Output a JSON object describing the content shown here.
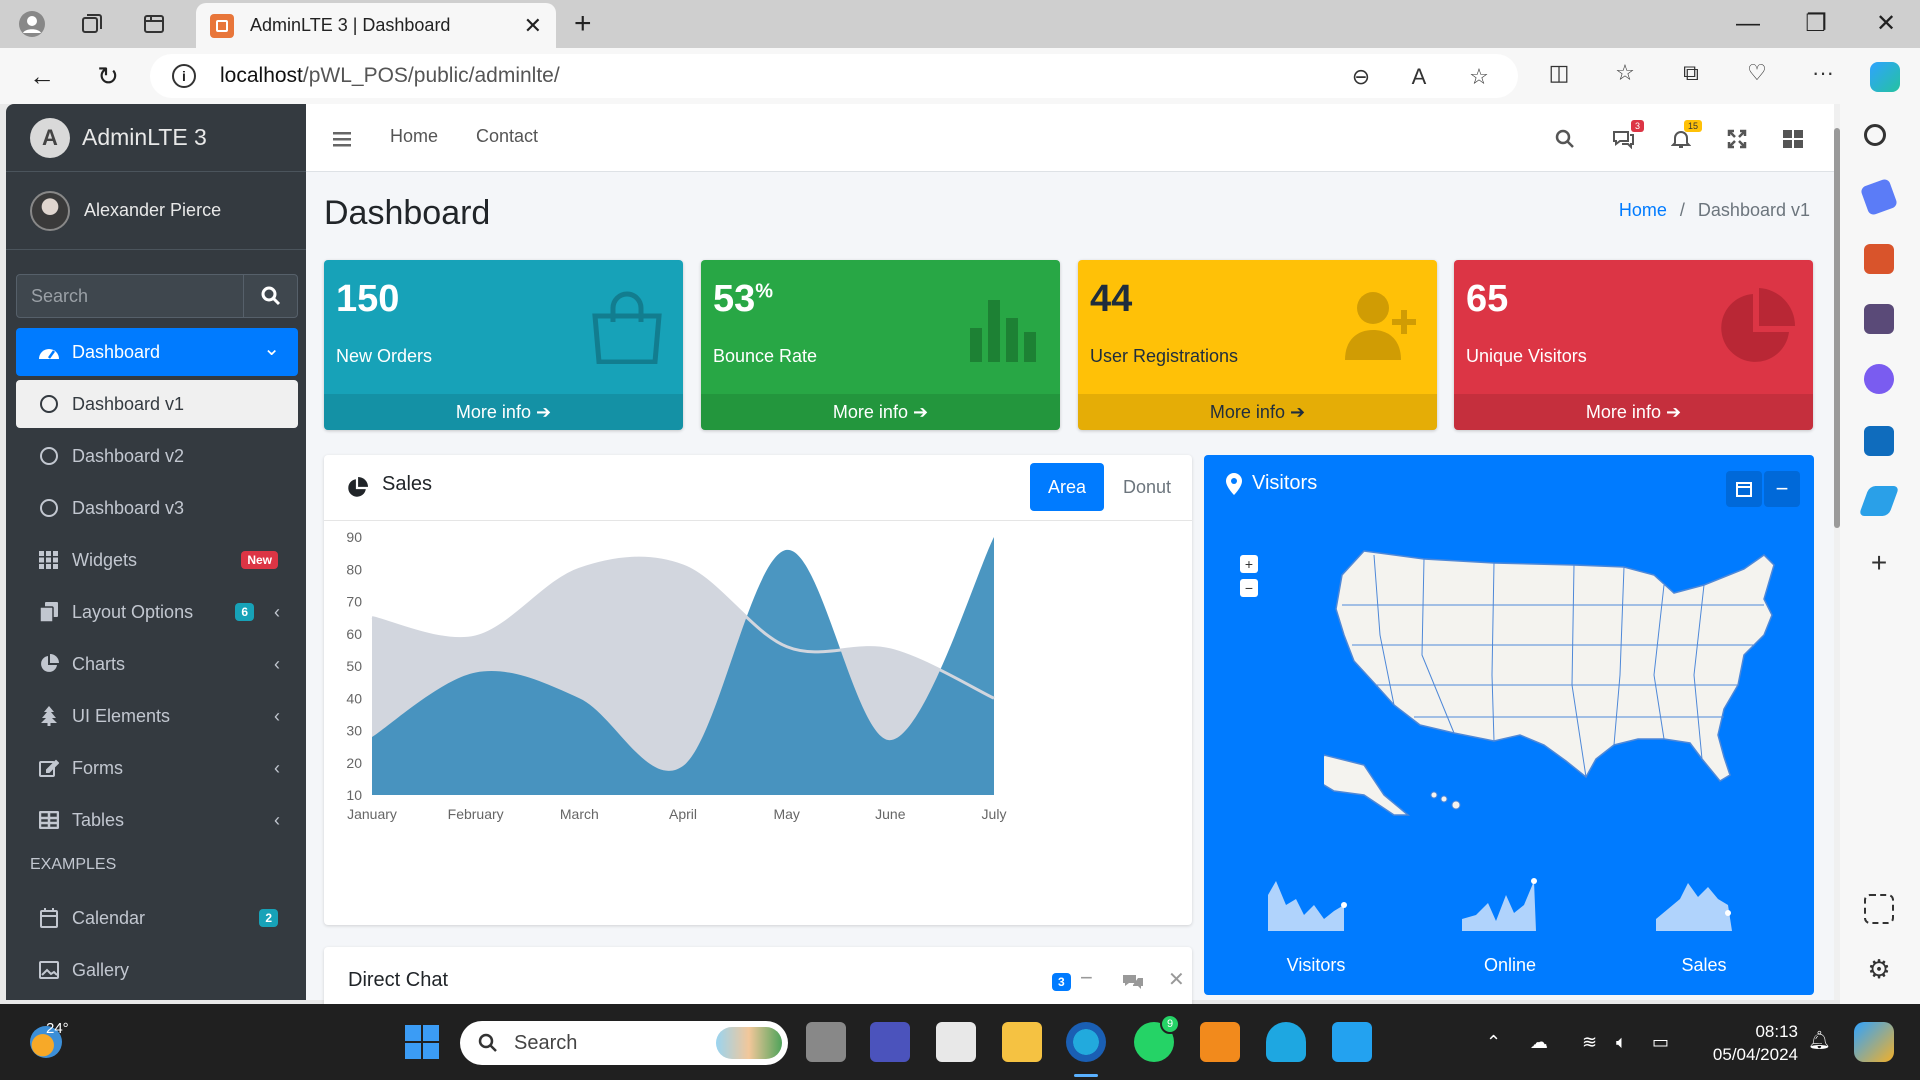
{
  "browser": {
    "tab_title": "AdminLTE 3 | Dashboard",
    "url_host": "localhost",
    "url_path": "/pWL_POS/public/adminlte/"
  },
  "sidebar": {
    "brand": "AdminLTE 3",
    "user": "Alexander Pierce",
    "search_placeholder": "Search",
    "items": [
      {
        "label": "Dashboard",
        "arrow": "⌄"
      },
      {
        "label": "Dashboard v1"
      },
      {
        "label": "Dashboard v2"
      },
      {
        "label": "Dashboard v3"
      },
      {
        "label": "Widgets",
        "badge": "New"
      },
      {
        "label": "Layout Options",
        "badge": "6",
        "arrow": "‹"
      },
      {
        "label": "Charts",
        "arrow": "‹"
      },
      {
        "label": "UI Elements",
        "arrow": "‹"
      },
      {
        "label": "Forms",
        "arrow": "‹"
      },
      {
        "label": "Tables",
        "arrow": "‹"
      },
      {
        "label": "Calendar",
        "badge": "2"
      },
      {
        "label": "Gallery"
      }
    ],
    "section_examples": "EXAMPLES"
  },
  "topnav": {
    "home": "Home",
    "contact": "Contact",
    "messages_count": "3",
    "notifications_count": "15"
  },
  "page": {
    "title": "Dashboard",
    "breadcrumb_home": "Home",
    "breadcrumb_sep": "/",
    "breadcrumb_current": "Dashboard v1"
  },
  "stats": [
    {
      "value": "150",
      "suffix": "",
      "label": "New Orders",
      "more": "More info",
      "color": "#17a2b8"
    },
    {
      "value": "53",
      "suffix": "%",
      "label": "Bounce Rate",
      "more": "More info",
      "color": "#28a745"
    },
    {
      "value": "44",
      "suffix": "",
      "label": "User Registrations",
      "more": "More info",
      "color": "#ffc107"
    },
    {
      "value": "65",
      "suffix": "",
      "label": "Unique Visitors",
      "more": "More info",
      "color": "#dc3545"
    }
  ],
  "sales": {
    "title": "Sales",
    "tab_area": "Area",
    "tab_donut": "Donut"
  },
  "chat": {
    "title": "Direct Chat",
    "count": "3"
  },
  "visitors": {
    "title": "Visitors",
    "labels": [
      "Visitors",
      "Online",
      "Sales"
    ]
  },
  "chart_data": {
    "type": "area",
    "categories": [
      "January",
      "February",
      "March",
      "April",
      "May",
      "June",
      "July"
    ],
    "ylim": [
      10,
      90
    ],
    "yticks": [
      10,
      20,
      30,
      40,
      50,
      60,
      70,
      80,
      90
    ],
    "series": [
      {
        "color": "#d2d6de",
        "values": [
          65,
          59,
          80,
          81,
          56,
          55,
          40
        ]
      },
      {
        "color": "#3c8dbc",
        "values": [
          28,
          48,
          40,
          19,
          86,
          27,
          90
        ]
      }
    ]
  },
  "taskbar": {
    "temperature": "24°",
    "search": "Search",
    "time": "08:13",
    "date": "05/04/2024",
    "whatsapp_badge": "9"
  }
}
